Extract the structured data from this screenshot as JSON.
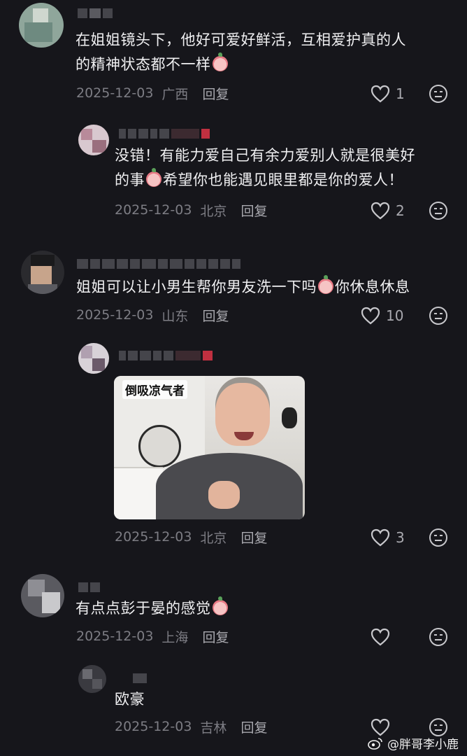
{
  "comments": [
    {
      "text_line1": "在姐姐镜头下，他好可爱好鲜活，互相爱护真的人",
      "text_line2": "的精神状态都不一样",
      "date": "2025-12-03",
      "location": "广西",
      "reply_label": "回复",
      "likes": "1"
    },
    {
      "text_line1": "没错！有能力爱自己有余力爱别人就是很美好",
      "text_line2_a": "的事",
      "text_line2_b": "希望你也能遇见眼里都是你的爱人！",
      "date": "2025-12-03",
      "location": "北京",
      "reply_label": "回复",
      "likes": "2"
    },
    {
      "text_a": "姐姐可以让小男生帮你男友洗一下吗",
      "text_b": "你休息休息",
      "date": "2025-12-03",
      "location": "山东",
      "reply_label": "回复",
      "likes": "10"
    },
    {
      "meme_caption": "倒吸凉气者",
      "date": "2025-12-03",
      "location": "北京",
      "reply_label": "回复",
      "likes": "3"
    },
    {
      "text": "有点点彭于晏的感觉",
      "date": "2025-12-03",
      "location": "上海",
      "reply_label": "回复",
      "likes": ""
    },
    {
      "text": "欧豪",
      "date": "2025-12-03",
      "location": "吉林",
      "reply_label": "回复",
      "likes": ""
    }
  ],
  "watermark": "@胖哥李小鹿",
  "icons": {
    "like": "heart-outline-icon",
    "dislike": "neutral-face-icon",
    "emoji": "peach-emoji-icon",
    "weibo": "weibo-logo-icon"
  },
  "colors": {
    "background": "#16161b",
    "text": "#f0f0f2",
    "meta": "#7d7d84"
  }
}
